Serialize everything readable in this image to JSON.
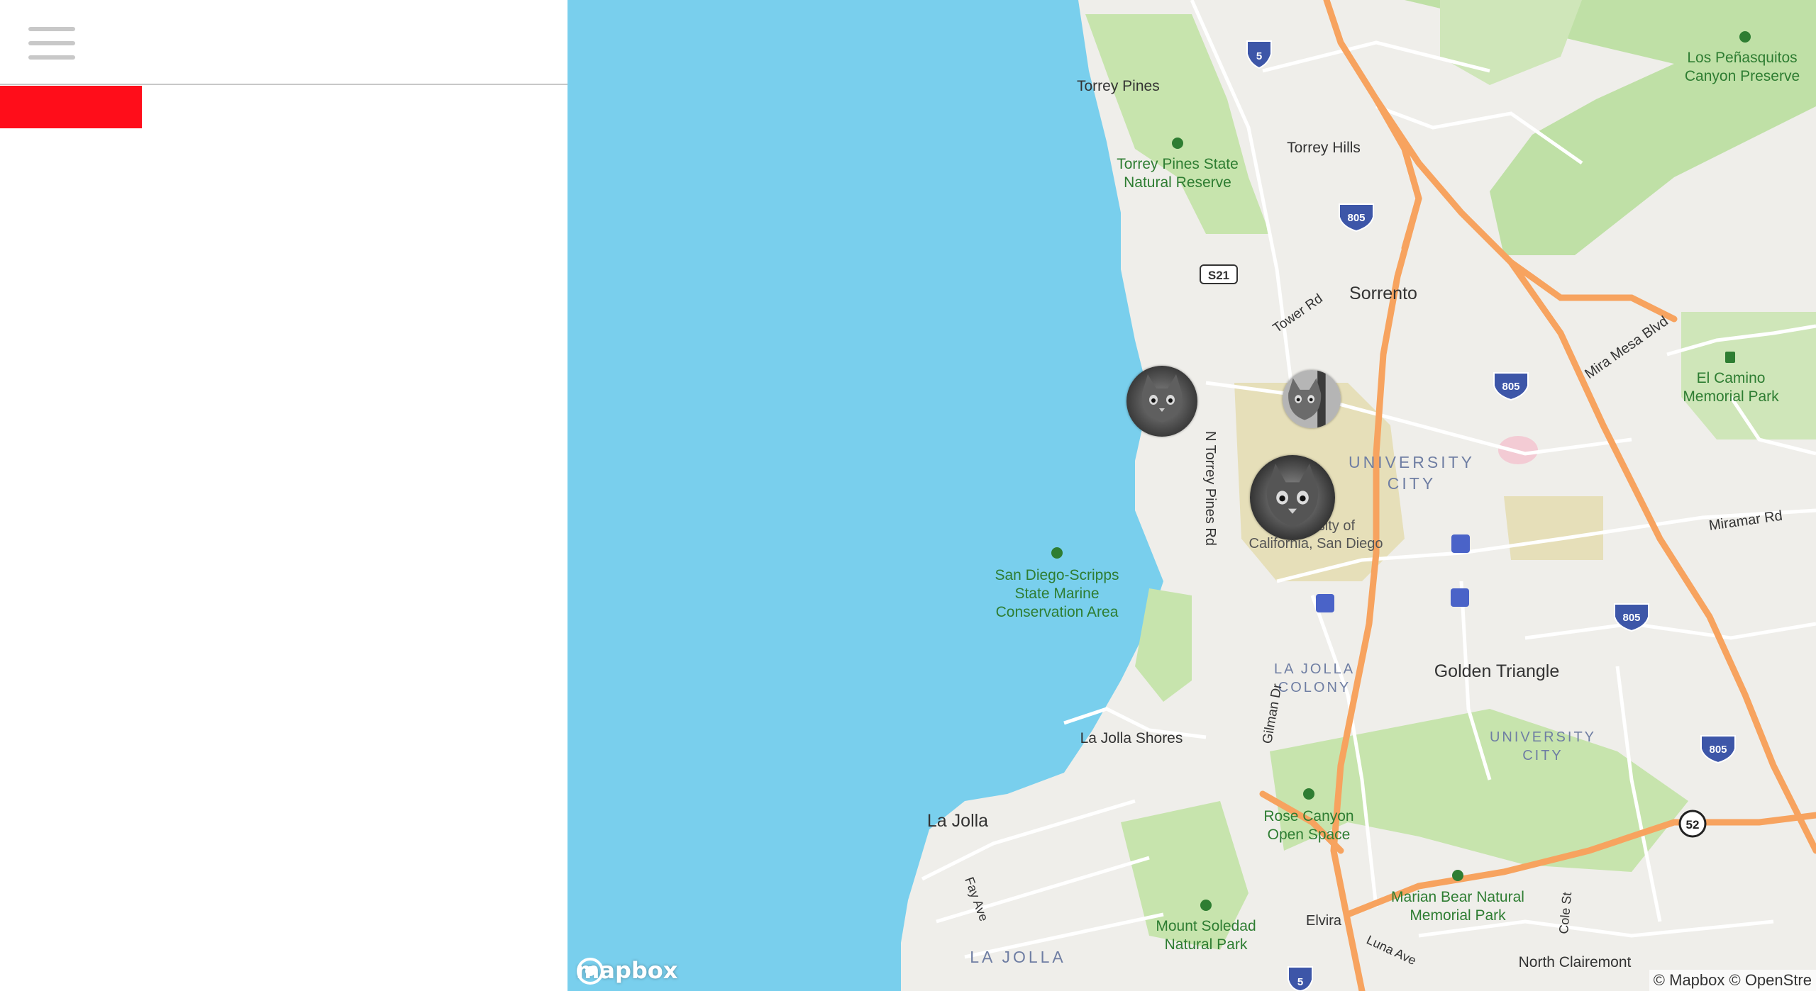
{
  "sidebar": {
    "menu_icon": "hamburger-menu-icon",
    "accent_color": "#ff0d1a"
  },
  "map": {
    "ocean_color": "#79cfed",
    "land_color": "#efeeea",
    "park_color": "#bfe0a6",
    "highway_color": "#f7a35f",
    "labels": {
      "torrey_pines": "Torrey Pines",
      "torrey_hills": "Torrey Hills",
      "los_penasquitos": "Los Peñasquitos",
      "canyon_preserve": "Canyon Preserve",
      "tp_reserve_1": "Torrey Pines State",
      "tp_reserve_2": "Natural Reserve",
      "sorrento": "Sorrento",
      "tower_rd": "Tower Rd",
      "mira_mesa_blvd": "Mira Mesa Blvd",
      "el_camino_1": "El Camino",
      "el_camino_2": "Memorial Park",
      "university_1": "UNIVERSITY",
      "university_2": "CITY",
      "n_torrey_pines_rd": "N Torrey Pines Rd",
      "ucsd_1": "University of",
      "ucsd_2": "California, San Diego",
      "miramar_rd": "Miramar Rd",
      "scripps_1": "San Diego-Scripps",
      "scripps_2": "State Marine",
      "scripps_3": "Conservation Area",
      "la_jolla_colony_1": "LA JOLLA",
      "la_jolla_colony_2": "COLONY",
      "golden_triangle": "Golden Triangle",
      "gilman_dr": "Gilman Dr",
      "la_jolla_shores": "La Jolla Shores",
      "university_city_2a": "UNIVERSITY",
      "university_city_2b": "CITY",
      "la_jolla": "La Jolla",
      "rose_canyon_1": "Rose Canyon",
      "rose_canyon_2": "Open Space",
      "fay_ave": "Fay Ave",
      "marian_bear_1": "Marian Bear Natural",
      "marian_bear_2": "Memorial Park",
      "cole_st": "Cole St",
      "mount_soledad_1": "Mount Soledad",
      "mount_soledad_2": "Natural Park",
      "elvira": "Elvira",
      "luna_ave": "Luna Ave",
      "north_clairemont": "North Clairemont",
      "la_jolla_district": "LA JOLLA"
    },
    "shields": {
      "i5_top": "5",
      "i805_1": "805",
      "sr521": "S21",
      "i805_2": "805",
      "i805_3": "805",
      "i805_4": "805",
      "sr52": "52",
      "i5_bottom": "5"
    },
    "markers": [
      {
        "name": "cat-photo-marker-1",
        "icon": "cat-photo-marker"
      },
      {
        "name": "cat-photo-marker-2",
        "icon": "cat-photo-marker"
      },
      {
        "name": "cat-photo-marker-3",
        "icon": "cat-photo-marker"
      }
    ],
    "logo_text": "mapbox",
    "attribution": "© Mapbox © OpenStre"
  }
}
